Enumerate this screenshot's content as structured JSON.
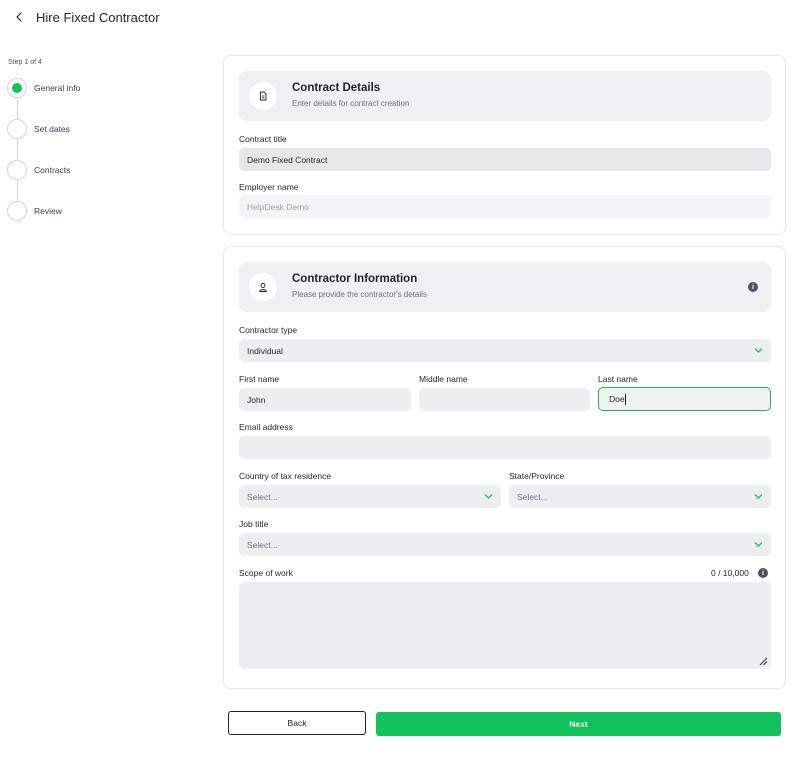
{
  "header": {
    "title": "Hire Fixed Contractor",
    "back_icon": "chevron-left-icon"
  },
  "stepper": {
    "count_text": "Step 1 of 4",
    "active_color": "#10c25a",
    "steps": [
      {
        "label": "General info",
        "active": true
      },
      {
        "label": "Set dates",
        "active": false
      },
      {
        "label": "Contracts",
        "active": false
      },
      {
        "label": "Review",
        "active": false
      }
    ]
  },
  "contract_details": {
    "title": "Contract Details",
    "subtitle": "Enter details for contract creation",
    "icon": "document-icon",
    "contract_title": {
      "label": "Contract title",
      "value": "Demo Fixed Contract"
    },
    "employer_name": {
      "label": "Employer name",
      "value": "HelpDesk Demo"
    }
  },
  "contractor_info": {
    "title": "Contractor Information",
    "subtitle": "Please provide the contractor's details",
    "icon": "user-icon",
    "contractor_type": {
      "label": "Contractor type",
      "value": "Individual"
    },
    "first_name": {
      "label": "First name",
      "value": "John"
    },
    "middle_name": {
      "label": "Middle name",
      "value": ""
    },
    "last_name": {
      "label": "Last name",
      "value": "Doe"
    },
    "email": {
      "label": "Email address",
      "value": ""
    },
    "country": {
      "label": "Country of tax residence",
      "placeholder": "Select..."
    },
    "state": {
      "label": "State/Province",
      "placeholder": "Select..."
    },
    "job_title": {
      "label": "Job title",
      "placeholder": "Select..."
    },
    "scope": {
      "label": "Scope of work",
      "count": "0 / 10,000"
    }
  },
  "actions": {
    "back_label": "Back",
    "next_label": "Next"
  }
}
